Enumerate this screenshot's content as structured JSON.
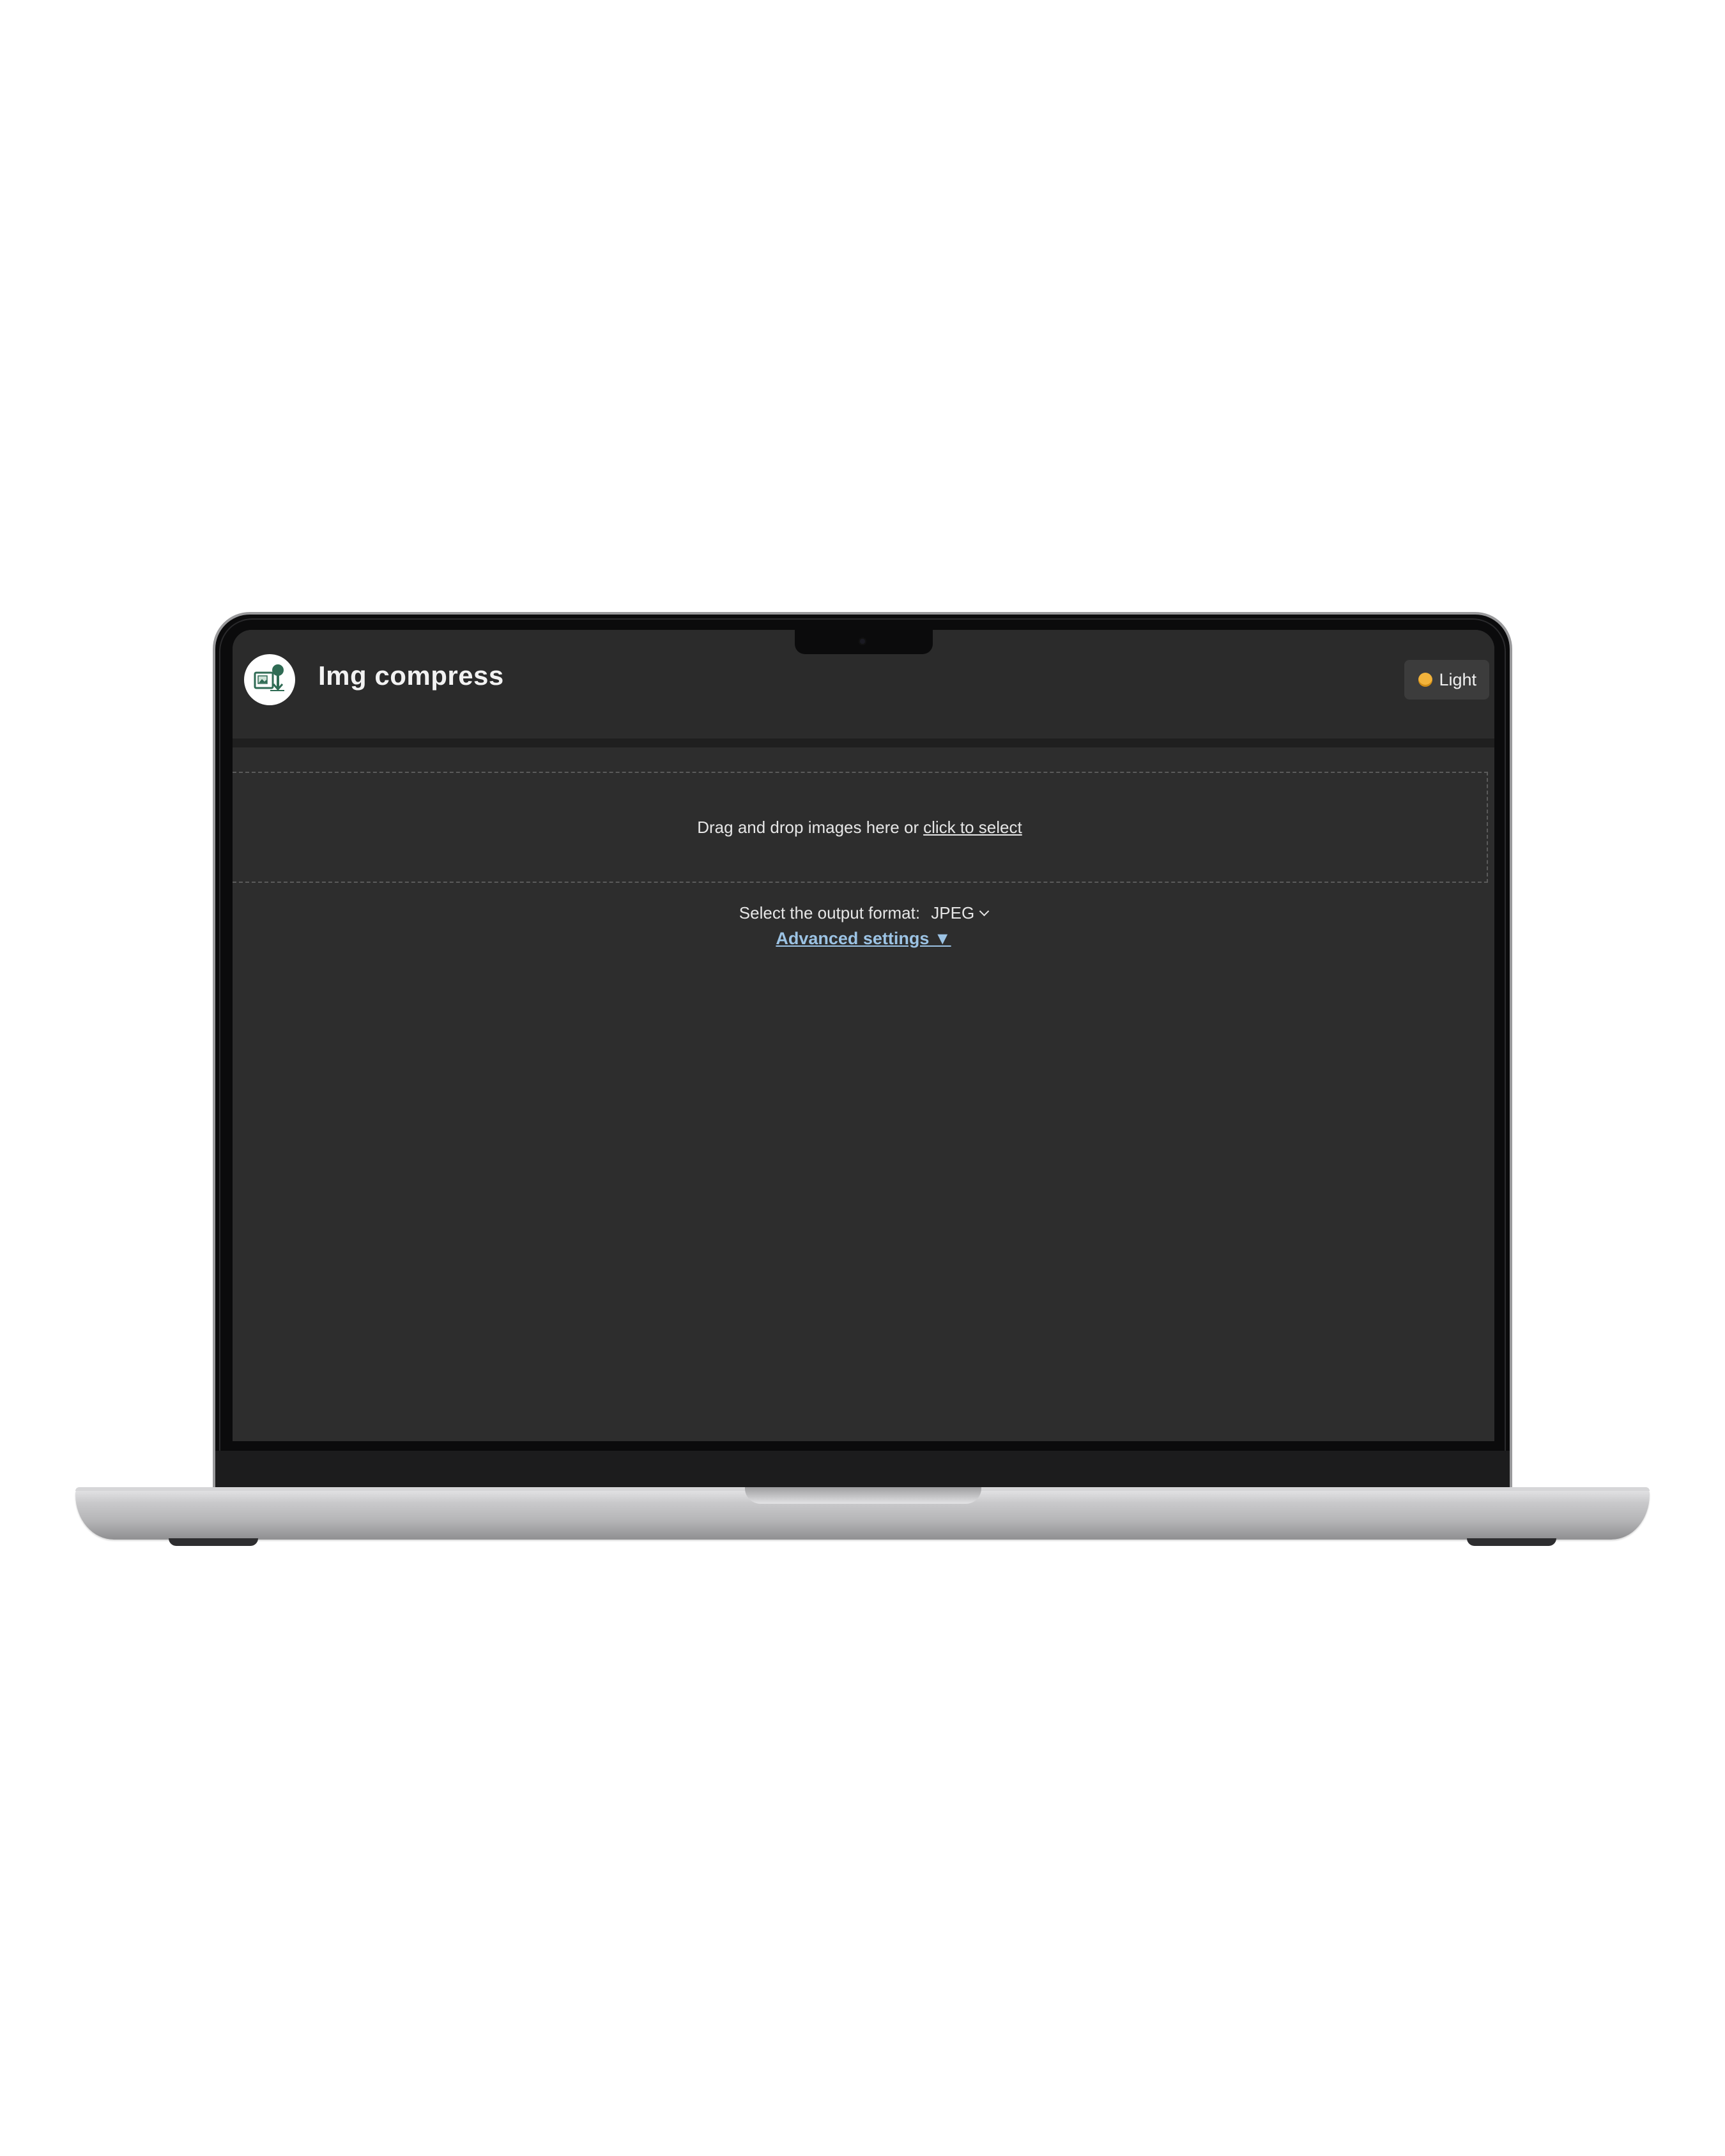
{
  "app": {
    "title": "Img compress",
    "logo_icon": "image-compress-logo-icon"
  },
  "header": {
    "theme_toggle": {
      "icon": "sun-icon",
      "label": "Light"
    }
  },
  "dropzone": {
    "text": "Drag and drop images here or",
    "link_label": "click to select"
  },
  "output_format": {
    "label": "Select the output format:",
    "selected": "JPEG"
  },
  "advanced": {
    "label": "Advanced settings ▼"
  },
  "colors": {
    "screen_bg": "#2d2d2d",
    "header_bg": "#2b2b2b",
    "link_accent": "#9cc3e4",
    "theme_button_bg": "#3c3c3c"
  }
}
